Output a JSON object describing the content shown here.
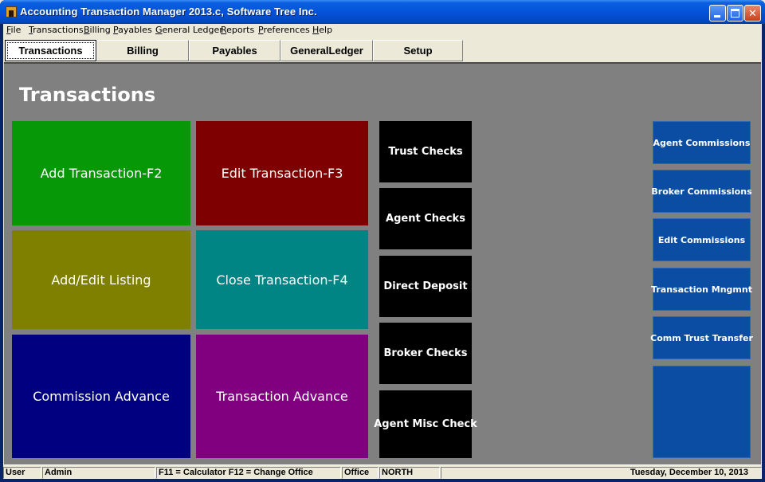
{
  "window": {
    "title": "Accounting Transaction Manager 2013.c,  Software Tree Inc.",
    "controls": {
      "minimize": "minimize-button",
      "maximize": "maximize-button",
      "close": "✕"
    }
  },
  "menu": {
    "items": [
      {
        "u": "F",
        "rest": "ile"
      },
      {
        "u": "T",
        "rest": "ransactions"
      },
      {
        "u": "B",
        "rest": "illing"
      },
      {
        "u": "P",
        "rest": "ayables"
      },
      {
        "u": "G",
        "rest": "eneral Ledger"
      },
      {
        "u": "R",
        "rest": "eports"
      },
      {
        "u": "P",
        "rest": "references"
      },
      {
        "u": "H",
        "rest": "elp"
      }
    ]
  },
  "tabs": [
    "Transactions",
    "Billing",
    "Payables",
    "GeneralLedger",
    "Setup"
  ],
  "active_tab": "Transactions",
  "page": {
    "title": "Transactions"
  },
  "tiles": [
    {
      "label": "Add Transaction-F2",
      "color": "#069806"
    },
    {
      "label": "Edit Transaction-F3",
      "color": "#7f0000"
    },
    {
      "label": "Add/Edit Listing",
      "color": "#7f7f00"
    },
    {
      "label": "Close Transaction-F4",
      "color": "#008584"
    },
    {
      "label": "Commission Advance",
      "color": "#000080"
    },
    {
      "label": "Transaction Advance",
      "color": "#800080"
    }
  ],
  "checks": [
    "Trust Checks",
    "Agent Checks",
    "Direct Deposit",
    "Broker Checks",
    "Agent Misc Check"
  ],
  "side_buttons": [
    "Agent Commissions",
    "Broker Commissions",
    "Edit Commissions",
    "Transaction Mngmnt",
    "Comm Trust Transfer",
    ""
  ],
  "status": {
    "user_label": "User",
    "user_value": "Admin",
    "shortcuts": "F11 = Calculator   F12 = Change Office",
    "office_label": "Office",
    "office_value": "NORTH",
    "date": "Tuesday, December 10, 2013"
  }
}
